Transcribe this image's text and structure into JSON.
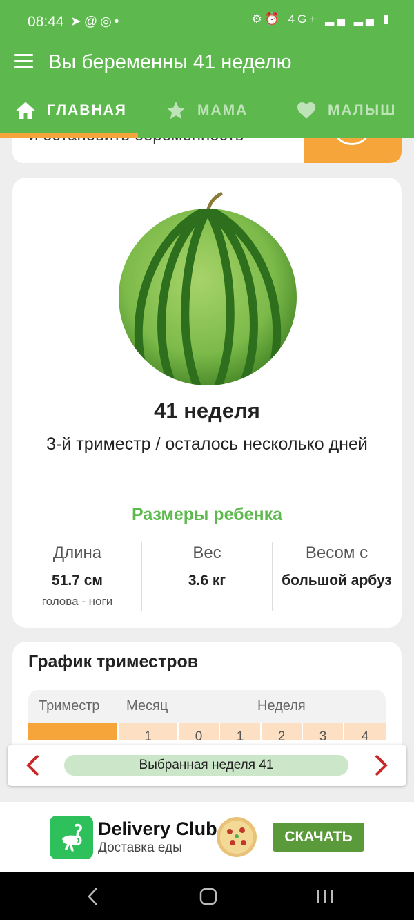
{
  "status_bar": {
    "time": "08:44",
    "left_icons": "➤@◎•",
    "right_icons": "⚙⏰ 4G+ ▂▄ ▂▄ ▮"
  },
  "app_bar": {
    "title": "Вы беременны 41 неделю",
    "menu_icon": "hamburger-menu"
  },
  "tabs": [
    {
      "label": "ГЛАВНАЯ",
      "icon": "home-icon",
      "active": true
    },
    {
      "label": "МАМА",
      "icon": "star-icon",
      "active": false
    },
    {
      "label": "МАЛЫШ",
      "icon": "heart-icon",
      "active": false
    }
  ],
  "prev_card": {
    "text": "и остановить беременность"
  },
  "week_card": {
    "image": "watermelon",
    "week_title": "41 неделя",
    "trimester_text": "3-й триместр / осталось несколько дней",
    "sizes_title": "Размеры ребенка",
    "stats": [
      {
        "label": "Длина",
        "value": "51.7 см",
        "sub": "голова - ноги"
      },
      {
        "label": "Вес",
        "value": "3.6 кг",
        "sub": ""
      },
      {
        "label": "Весом с",
        "value": "большой арбуз",
        "sub": ""
      }
    ]
  },
  "trimester_card": {
    "title": "График триместров",
    "headers": [
      "Триместр",
      "Месяц",
      "Неделя"
    ],
    "first_row": {
      "month": "1",
      "weeks": [
        "0",
        "1",
        "2",
        "3",
        "4"
      ]
    }
  },
  "week_nav": {
    "selected_label": "Выбранная неделя 41"
  },
  "ad": {
    "title": "Delivery Club",
    "subtitle": "Доставка еды",
    "button": "СКАЧАТЬ"
  },
  "colors": {
    "primary_green": "#5db94e",
    "accent_orange": "#f5a53a",
    "nav_red": "#c62828"
  }
}
